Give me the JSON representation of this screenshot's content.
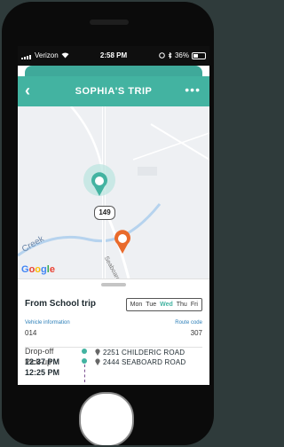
{
  "status_bar": {
    "carrier": "Verizon",
    "time": "2:58 PM",
    "battery": "36%",
    "icons": [
      "signal-bars-icon",
      "wifi-icon",
      "alarm-icon",
      "bluetooth-icon",
      "battery-icon"
    ]
  },
  "header": {
    "title": "SOPHIA'S TRIP",
    "back_icon": "chevron-left-icon",
    "more_icon": "more-horizontal-icon",
    "color": "#43b3a1"
  },
  "map": {
    "route_shield": "149",
    "water_label": "Creek",
    "road_label": "Seaboard Road",
    "attribution": "Google",
    "markers": [
      "school-marker-icon",
      "school-marker-icon"
    ]
  },
  "trip": {
    "name": "From School trip",
    "days": [
      "Mon",
      "Tue",
      "Wed",
      "Thu",
      "Fri"
    ],
    "active_day": "Wed",
    "vehicle_label": "Vehicle information",
    "vehicle_value": "014",
    "route_label": "Route code",
    "route_value": "307"
  },
  "stops": [
    {
      "label": "Pick-up",
      "time": "12:25 PM",
      "address": "2444 SEABOARD ROAD"
    },
    {
      "label": "Drop-off",
      "time": "12:37 PM",
      "address": "2251 CHILDERIC ROAD"
    }
  ]
}
